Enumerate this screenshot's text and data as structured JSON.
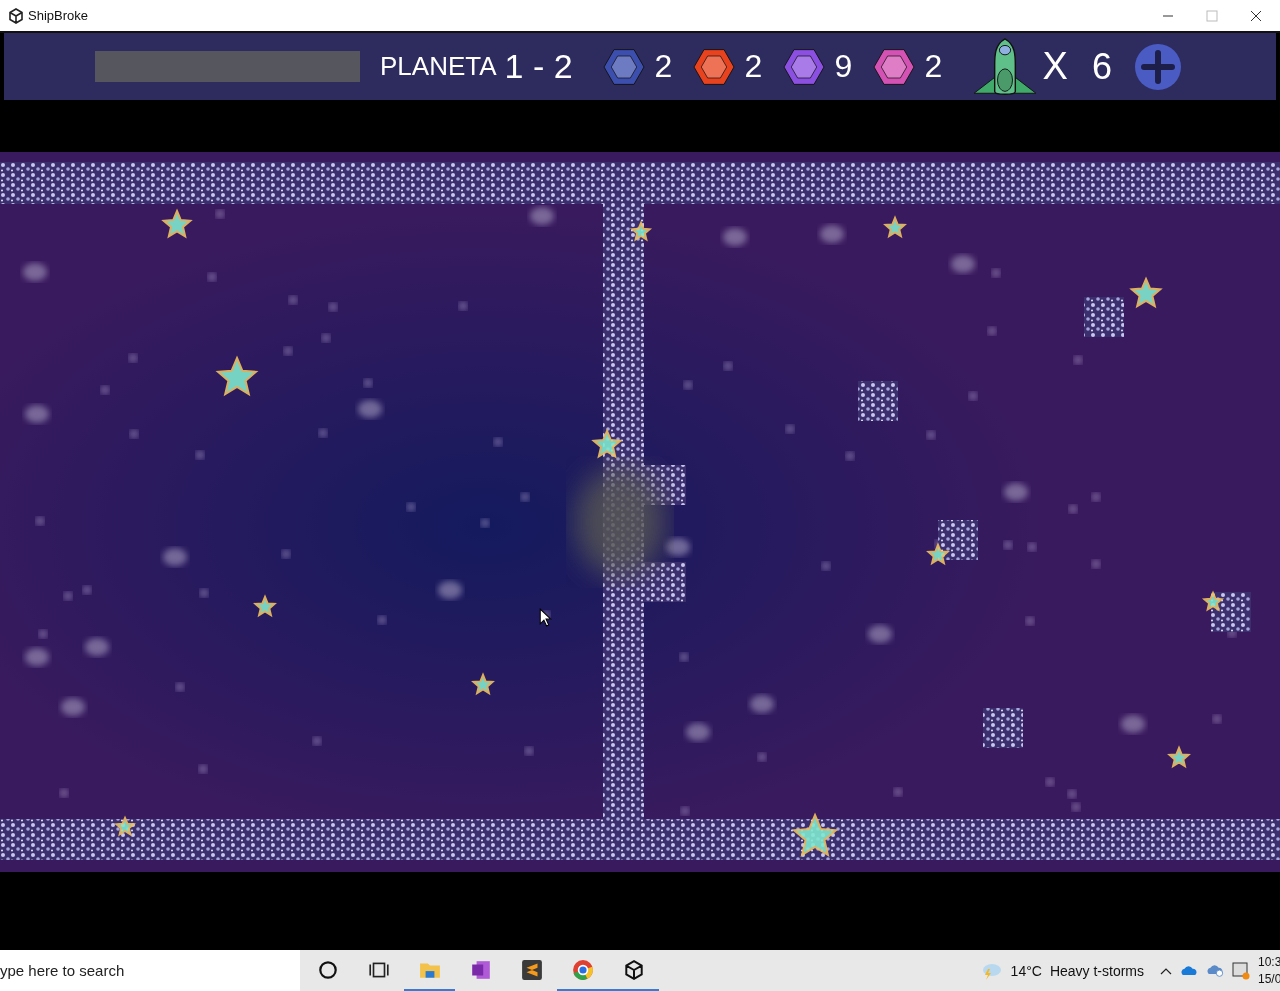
{
  "window": {
    "title": "ShipBroke"
  },
  "hud": {
    "planet_label": "PLANETA",
    "planet_value": "1 - 2",
    "gems": [
      {
        "color": "#3d4fae",
        "count": "2"
      },
      {
        "color": "#e8431e",
        "count": "2"
      },
      {
        "color": "#8b4fe2",
        "count": "9"
      },
      {
        "color": "#d452b4",
        "count": "2"
      }
    ],
    "lives_sign": "X",
    "lives_count": "6"
  },
  "taskbar": {
    "search": {
      "placeholder": "ype here to search"
    },
    "apps": [
      {
        "kind": "cortana",
        "selected": false
      },
      {
        "kind": "taskview",
        "selected": false
      },
      {
        "kind": "explorer",
        "selected": true
      },
      {
        "kind": "onenote",
        "selected": false
      },
      {
        "kind": "sublime",
        "selected": false
      },
      {
        "kind": "chrome",
        "selected": true
      },
      {
        "kind": "unity",
        "selected": true
      }
    ],
    "weather_temp": "14°C",
    "weather_text": "Heavy t-storms",
    "time": "10:3",
    "date": "15/0"
  }
}
